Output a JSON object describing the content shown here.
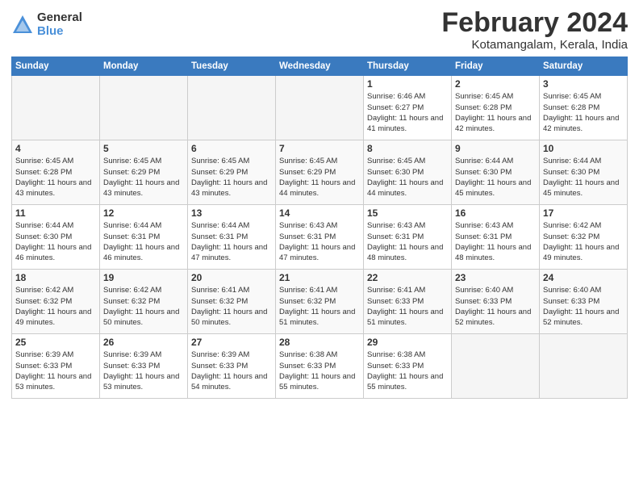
{
  "logo": {
    "general": "General",
    "blue": "Blue"
  },
  "title": "February 2024",
  "location": "Kotamangalam, Kerala, India",
  "headers": [
    "Sunday",
    "Monday",
    "Tuesday",
    "Wednesday",
    "Thursday",
    "Friday",
    "Saturday"
  ],
  "weeks": [
    [
      {
        "day": "",
        "empty": true
      },
      {
        "day": "",
        "empty": true
      },
      {
        "day": "",
        "empty": true
      },
      {
        "day": "",
        "empty": true
      },
      {
        "day": "1",
        "sunrise": "6:46 AM",
        "sunset": "6:27 PM",
        "daylight": "11 hours and 41 minutes."
      },
      {
        "day": "2",
        "sunrise": "6:45 AM",
        "sunset": "6:28 PM",
        "daylight": "11 hours and 42 minutes."
      },
      {
        "day": "3",
        "sunrise": "6:45 AM",
        "sunset": "6:28 PM",
        "daylight": "11 hours and 42 minutes."
      }
    ],
    [
      {
        "day": "4",
        "sunrise": "6:45 AM",
        "sunset": "6:28 PM",
        "daylight": "11 hours and 43 minutes."
      },
      {
        "day": "5",
        "sunrise": "6:45 AM",
        "sunset": "6:29 PM",
        "daylight": "11 hours and 43 minutes."
      },
      {
        "day": "6",
        "sunrise": "6:45 AM",
        "sunset": "6:29 PM",
        "daylight": "11 hours and 43 minutes."
      },
      {
        "day": "7",
        "sunrise": "6:45 AM",
        "sunset": "6:29 PM",
        "daylight": "11 hours and 44 minutes."
      },
      {
        "day": "8",
        "sunrise": "6:45 AM",
        "sunset": "6:30 PM",
        "daylight": "11 hours and 44 minutes."
      },
      {
        "day": "9",
        "sunrise": "6:44 AM",
        "sunset": "6:30 PM",
        "daylight": "11 hours and 45 minutes."
      },
      {
        "day": "10",
        "sunrise": "6:44 AM",
        "sunset": "6:30 PM",
        "daylight": "11 hours and 45 minutes."
      }
    ],
    [
      {
        "day": "11",
        "sunrise": "6:44 AM",
        "sunset": "6:30 PM",
        "daylight": "11 hours and 46 minutes."
      },
      {
        "day": "12",
        "sunrise": "6:44 AM",
        "sunset": "6:31 PM",
        "daylight": "11 hours and 46 minutes."
      },
      {
        "day": "13",
        "sunrise": "6:44 AM",
        "sunset": "6:31 PM",
        "daylight": "11 hours and 47 minutes."
      },
      {
        "day": "14",
        "sunrise": "6:43 AM",
        "sunset": "6:31 PM",
        "daylight": "11 hours and 47 minutes."
      },
      {
        "day": "15",
        "sunrise": "6:43 AM",
        "sunset": "6:31 PM",
        "daylight": "11 hours and 48 minutes."
      },
      {
        "day": "16",
        "sunrise": "6:43 AM",
        "sunset": "6:31 PM",
        "daylight": "11 hours and 48 minutes."
      },
      {
        "day": "17",
        "sunrise": "6:42 AM",
        "sunset": "6:32 PM",
        "daylight": "11 hours and 49 minutes."
      }
    ],
    [
      {
        "day": "18",
        "sunrise": "6:42 AM",
        "sunset": "6:32 PM",
        "daylight": "11 hours and 49 minutes."
      },
      {
        "day": "19",
        "sunrise": "6:42 AM",
        "sunset": "6:32 PM",
        "daylight": "11 hours and 50 minutes."
      },
      {
        "day": "20",
        "sunrise": "6:41 AM",
        "sunset": "6:32 PM",
        "daylight": "11 hours and 50 minutes."
      },
      {
        "day": "21",
        "sunrise": "6:41 AM",
        "sunset": "6:32 PM",
        "daylight": "11 hours and 51 minutes."
      },
      {
        "day": "22",
        "sunrise": "6:41 AM",
        "sunset": "6:33 PM",
        "daylight": "11 hours and 51 minutes."
      },
      {
        "day": "23",
        "sunrise": "6:40 AM",
        "sunset": "6:33 PM",
        "daylight": "11 hours and 52 minutes."
      },
      {
        "day": "24",
        "sunrise": "6:40 AM",
        "sunset": "6:33 PM",
        "daylight": "11 hours and 52 minutes."
      }
    ],
    [
      {
        "day": "25",
        "sunrise": "6:39 AM",
        "sunset": "6:33 PM",
        "daylight": "11 hours and 53 minutes."
      },
      {
        "day": "26",
        "sunrise": "6:39 AM",
        "sunset": "6:33 PM",
        "daylight": "11 hours and 53 minutes."
      },
      {
        "day": "27",
        "sunrise": "6:39 AM",
        "sunset": "6:33 PM",
        "daylight": "11 hours and 54 minutes."
      },
      {
        "day": "28",
        "sunrise": "6:38 AM",
        "sunset": "6:33 PM",
        "daylight": "11 hours and 55 minutes."
      },
      {
        "day": "29",
        "sunrise": "6:38 AM",
        "sunset": "6:33 PM",
        "daylight": "11 hours and 55 minutes."
      },
      {
        "day": "",
        "empty": true
      },
      {
        "day": "",
        "empty": true
      }
    ]
  ]
}
